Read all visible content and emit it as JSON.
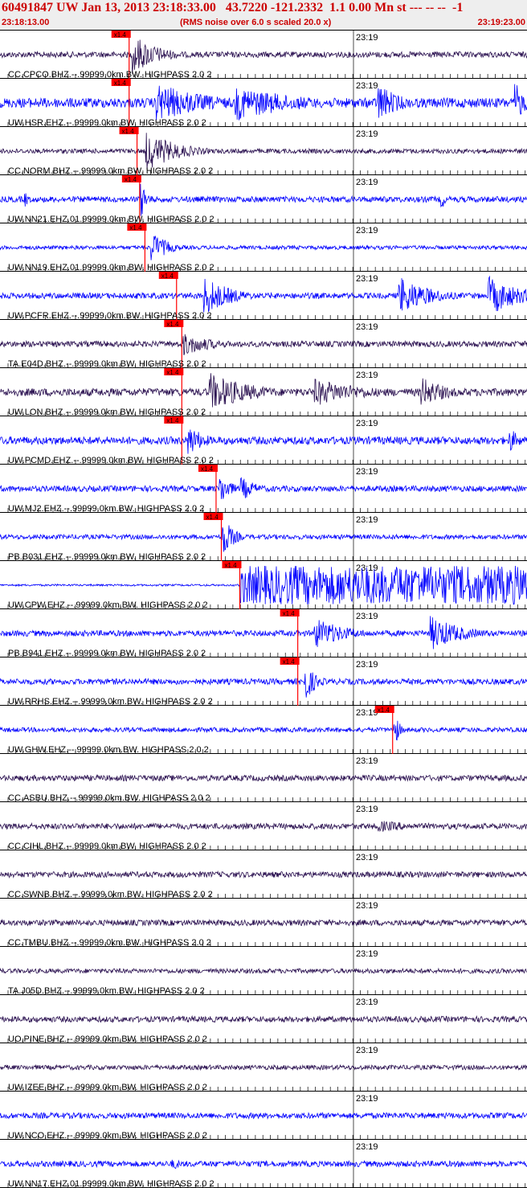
{
  "header": {
    "title": "60491847 UW Jan 13, 2013 23:18:33.00   43.7220 -121.2332  1.1 0.00 Mn st --- -- --  -1",
    "start_time": "23:18:13.00",
    "note": "(RMS noise over 6.0 s scaled 20.0 x)",
    "end_time": "23:19:23.00"
  },
  "minute_label": "23:19",
  "pick_label": "x1.4",
  "colors": {
    "blue": "#0000ff",
    "purple": "#2a1050",
    "pick": "#ff0000",
    "grid": "#000000"
  },
  "stations": [
    {
      "label": "CC.CPCO.BHZ.--.99999.0km.BW. HIGHPASS  2.0  2",
      "color": "purple",
      "pick": 0.245,
      "amp": 0.15,
      "events": [
        {
          "t": 0.255,
          "a": 1.0,
          "w": 0.05
        }
      ]
    },
    {
      "label": "UW.HSR.EHZ.--.99999.0km.BW. HIGHPASS  2.0  2",
      "color": "blue",
      "pick": 0.245,
      "amp": 0.25,
      "events": [
        {
          "t": 0.3,
          "a": 1.0,
          "w": 0.1
        },
        {
          "t": 0.45,
          "a": 0.9,
          "w": 0.12
        },
        {
          "t": 0.72,
          "a": 1.0,
          "w": 0.04
        },
        {
          "t": 0.98,
          "a": 1.0,
          "w": 0.02
        }
      ]
    },
    {
      "label": "CC.NORM.BHZ.--.99999.0km.BW. HIGHPASS  2.0  2",
      "color": "purple",
      "pick": 0.26,
      "amp": 0.12,
      "events": [
        {
          "t": 0.28,
          "a": 1.0,
          "w": 0.06
        }
      ]
    },
    {
      "label": "UW.NN21.EHZ.01.99999.0km.BW. HIGHPASS  2.0  2",
      "color": "blue",
      "pick": 0.265,
      "amp": 0.15,
      "events": [
        {
          "t": 0.27,
          "a": 0.9,
          "w": 0.01
        },
        {
          "t": 0.05,
          "a": 0.4,
          "w": 0.005
        },
        {
          "t": 0.84,
          "a": 0.5,
          "w": 0.005
        }
      ]
    },
    {
      "label": "UW.NN19.EHZ.01.99999.0km.BW. HIGHPASS  2.0  2",
      "color": "blue",
      "pick": 0.275,
      "amp": 0.1,
      "events": [
        {
          "t": 0.29,
          "a": 0.8,
          "w": 0.03
        }
      ]
    },
    {
      "label": "UW.PCFR.EHZ.--.99999.0km.BW. HIGHPASS  2.0  2",
      "color": "blue",
      "pick": 0.335,
      "amp": 0.15,
      "events": [
        {
          "t": 0.39,
          "a": 1.0,
          "w": 0.05
        },
        {
          "t": 0.76,
          "a": 1.0,
          "w": 0.06
        },
        {
          "t": 0.93,
          "a": 1.0,
          "w": 0.06
        }
      ]
    },
    {
      "label": "TA.E04D.BHZ.--.99999.0km.BW. HIGHPASS  2.0  2",
      "color": "purple",
      "pick": 0.345,
      "amp": 0.15,
      "events": [
        {
          "t": 0.35,
          "a": 0.6,
          "w": 0.06
        }
      ]
    },
    {
      "label": "UW.LON.BHZ.--.99999.0km.BW. HIGHPASS  2.0  2",
      "color": "purple",
      "pick": 0.345,
      "amp": 0.2,
      "events": [
        {
          "t": 0.4,
          "a": 1.0,
          "w": 0.08
        },
        {
          "t": 0.6,
          "a": 0.7,
          "w": 0.1
        },
        {
          "t": 0.8,
          "a": 0.8,
          "w": 0.05
        }
      ]
    },
    {
      "label": "UW.PCMD.EHZ.--.99999.0km.BW. HIGHPASS  2.0  2",
      "color": "blue",
      "pick": 0.345,
      "amp": 0.2,
      "events": [
        {
          "t": 0.36,
          "a": 0.8,
          "w": 0.03
        },
        {
          "t": 0.97,
          "a": 0.6,
          "w": 0.02
        }
      ]
    },
    {
      "label": "UW.MJ2.EHZ.--.99999.0km.BW. HIGHPASS  2.0  2",
      "color": "blue",
      "pick": 0.41,
      "amp": 0.15,
      "events": [
        {
          "t": 0.42,
          "a": 0.8,
          "w": 0.02
        },
        {
          "t": 0.46,
          "a": 0.6,
          "w": 0.03
        }
      ]
    },
    {
      "label": "PB.B031.EHZ.--.99999.0km.BW. HIGHPASS  2.0  2",
      "color": "blue",
      "pick": 0.42,
      "amp": 0.12,
      "events": [
        {
          "t": 0.425,
          "a": 1.0,
          "w": 0.02
        }
      ]
    },
    {
      "label": "UW.CPW.EHZ.--.99999.0km.BW. HIGHPASS  2.0  2",
      "color": "blue",
      "pick": 0.455,
      "amp": 0.05,
      "events": []
    },
    {
      "label": "PB.B941.EHZ.--.99999.0km.BW. HIGHPASS  2.0  2",
      "color": "blue",
      "pick": 0.565,
      "amp": 0.15,
      "events": [
        {
          "t": 0.6,
          "a": 0.8,
          "w": 0.06
        },
        {
          "t": 0.82,
          "a": 0.9,
          "w": 0.06
        }
      ]
    },
    {
      "label": "UW.RRHS.EHZ.--.99999.0km.BW. HIGHPASS  2.0  2",
      "color": "blue",
      "pick": 0.565,
      "amp": 0.15,
      "events": [
        {
          "t": 0.58,
          "a": 1.0,
          "w": 0.02
        }
      ]
    },
    {
      "label": "UW.GHW.EHZ.--.99999.0km.BW. HIGHPASS  2.0  2",
      "color": "blue",
      "pick": 0.745,
      "amp": 0.12,
      "events": [
        {
          "t": 0.75,
          "a": 0.8,
          "w": 0.01
        }
      ]
    },
    {
      "label": "CC.ASBU.BHZ.--.99999.0km.BW. HIGHPASS  2.0  2",
      "color": "purple",
      "pick": null,
      "amp": 0.15,
      "events": []
    },
    {
      "label": "CC.CIHL.BHZ.--.99999.0km.BW. HIGHPASS  2.0  2",
      "color": "purple",
      "pick": null,
      "amp": 0.15,
      "events": [
        {
          "t": 0.72,
          "a": 0.3,
          "w": 0.1
        }
      ]
    },
    {
      "label": "CC.SWNB.BHZ.--.99999.0km.BW. HIGHPASS  2.0  2",
      "color": "purple",
      "pick": null,
      "amp": 0.15,
      "events": []
    },
    {
      "label": "CC.TMBU.BHZ.--.99999.0km.BW. HIGHPASS  2.0  2",
      "color": "purple",
      "pick": null,
      "amp": 0.15,
      "events": []
    },
    {
      "label": "TA.J05D.BHZ.--.99999.0km.BW. HIGHPASS  2.0  2",
      "color": "purple",
      "pick": null,
      "amp": 0.12,
      "events": []
    },
    {
      "label": "UO.PINE.BHZ.--.99999.0km.BW. HIGHPASS  2.0  2",
      "color": "purple",
      "pick": null,
      "amp": 0.15,
      "events": []
    },
    {
      "label": "UW.IZEE.BHZ.--.99999.0km.BW. HIGHPASS  2.0  2",
      "color": "purple",
      "pick": null,
      "amp": 0.12,
      "events": []
    },
    {
      "label": "UW.NCO.EHZ.--.99999.0km.BW. HIGHPASS  2.0  2",
      "color": "blue",
      "pick": null,
      "amp": 0.15,
      "events": []
    },
    {
      "label": "UW.NN17.EHZ.01.99999.0km.BW. HIGHPASS  2.0  2",
      "color": "blue",
      "pick": null,
      "amp": 0.15,
      "events": [
        {
          "t": 0.33,
          "a": 0.3,
          "w": 0.02
        }
      ]
    }
  ]
}
